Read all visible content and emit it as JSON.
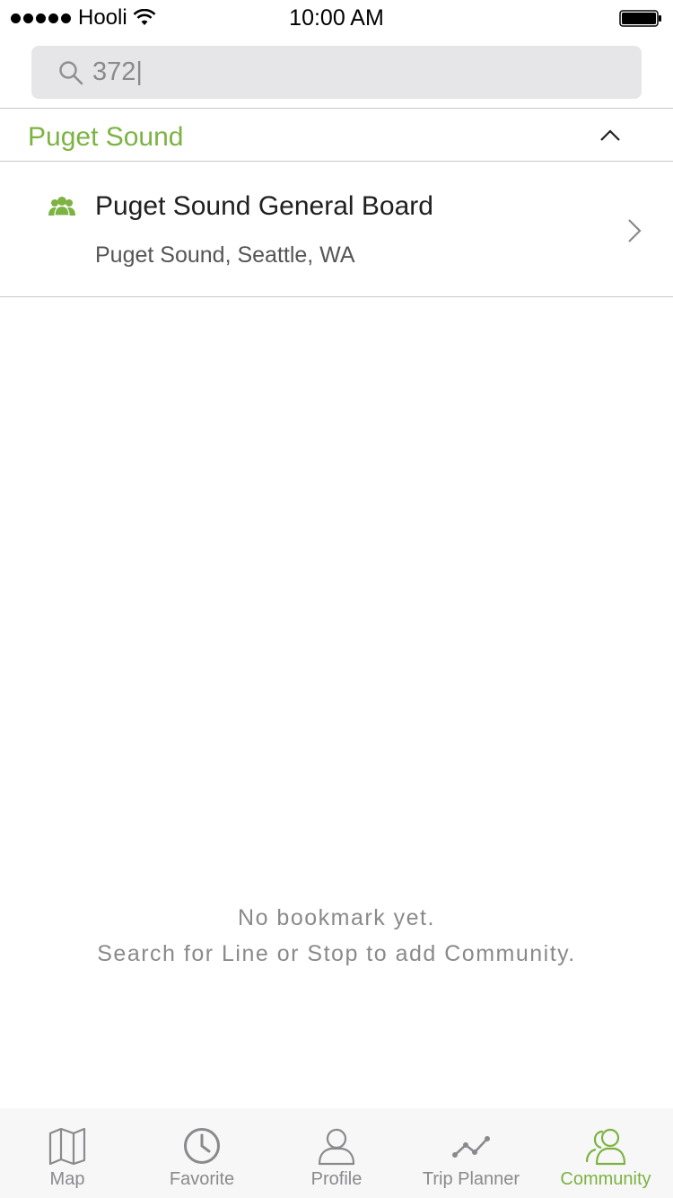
{
  "status_bar": {
    "carrier": "Hooli",
    "time": "10:00 AM",
    "icons": [
      "signal-dots-icon",
      "wifi-icon",
      "battery-icon"
    ]
  },
  "search": {
    "value": "372|",
    "placeholder": "",
    "icon": "search-icon"
  },
  "section": {
    "title": "Puget Sound",
    "collapse_icon": "chevron-up-icon"
  },
  "results": [
    {
      "title": "Puget Sound General Board",
      "subtitle": "Puget Sound, Seattle, WA",
      "icon": "community-icon"
    }
  ],
  "empty_state": {
    "line1": "No bookmark yet.",
    "line2": "Search for Line or Stop to add Community."
  },
  "tabs": [
    {
      "label": "Map",
      "icon": "map-icon",
      "active": false
    },
    {
      "label": "Favorite",
      "icon": "clock-icon",
      "active": false
    },
    {
      "label": "Profile",
      "icon": "profile-icon",
      "active": false
    },
    {
      "label": "Trip Planner",
      "icon": "trip-planner-icon",
      "active": false
    },
    {
      "label": "Community",
      "icon": "community-icon",
      "active": true
    }
  ],
  "colors": {
    "accent": "#7cb342",
    "inactive": "#8a8a8e",
    "search_bg": "#e6e6e8"
  }
}
